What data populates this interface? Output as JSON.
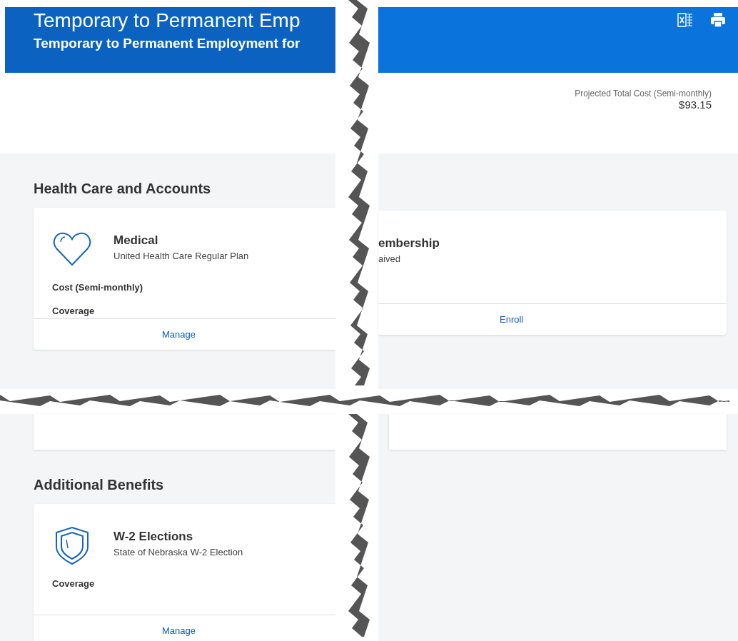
{
  "header": {
    "title": "Temporary to Permanent Emp",
    "subtitle": "Temporary to Permanent Employment for"
  },
  "projected_cost": {
    "label": "Projected Total Cost (Semi-monthly)",
    "amount": "$93.15"
  },
  "top_left": {
    "section_title": "Health Care and Accounts",
    "card": {
      "kind": "heart",
      "title": "Medical",
      "subtitle": "United Health Care Regular Plan",
      "fields": [
        "Cost (Semi-monthly)",
        "Coverage"
      ],
      "action": "Manage"
    }
  },
  "top_right": {
    "card": {
      "title": "embership",
      "subtitle": "aived",
      "action": "Enroll"
    }
  },
  "bottom_left": {
    "section_title": "Additional Benefits",
    "card": {
      "kind": "shield",
      "title": "W-2 Elections",
      "subtitle": "State of Nebraska W-2 Election",
      "fields": [
        "Coverage"
      ],
      "action": "Manage"
    }
  }
}
